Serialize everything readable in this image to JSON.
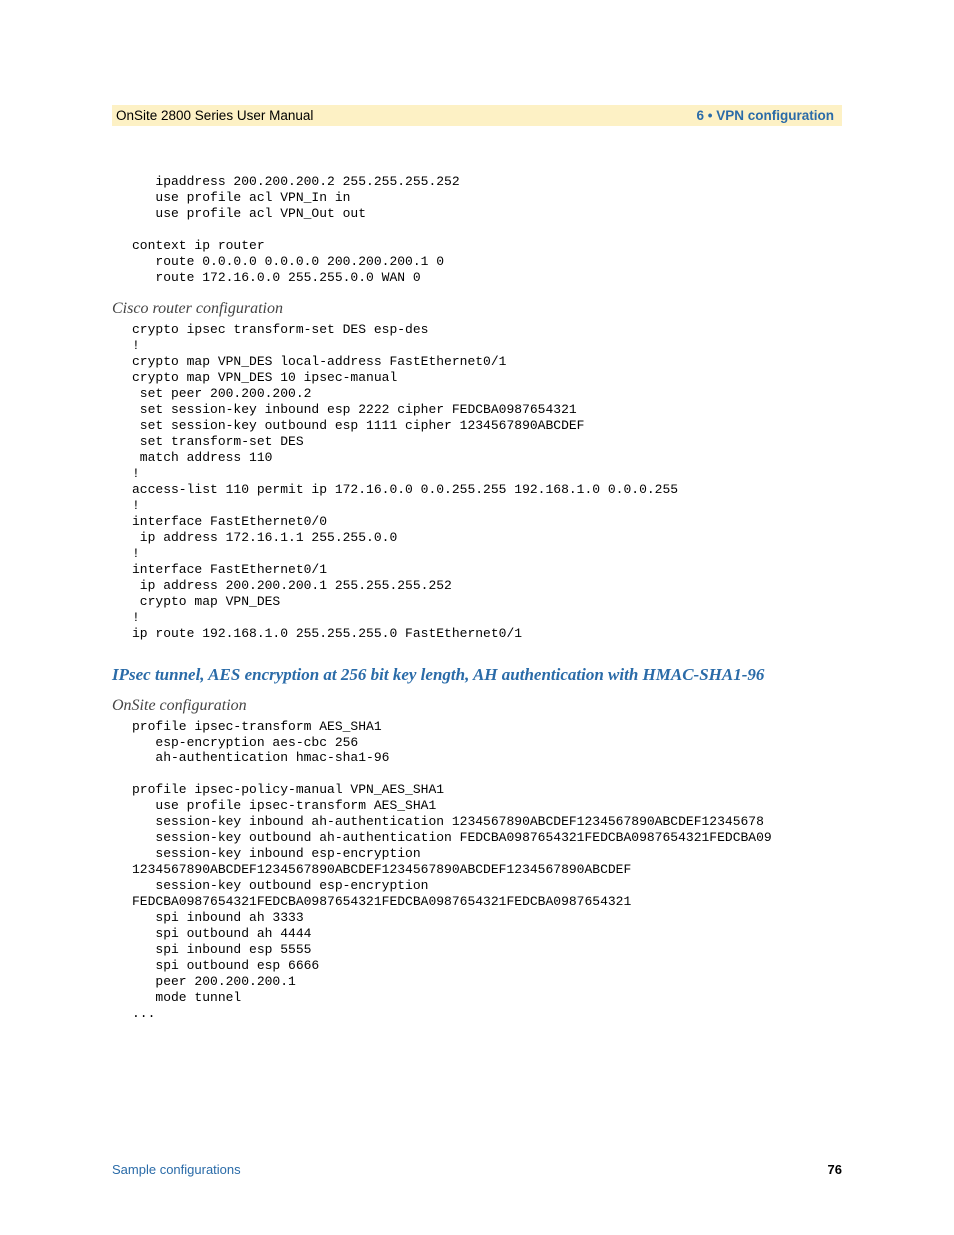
{
  "header": {
    "left": "OnSite 2800 Series User Manual",
    "right": "6 • VPN configuration"
  },
  "code1": "   ipaddress 200.200.200.2 255.255.255.252\n   use profile acl VPN_In in\n   use profile acl VPN_Out out\n\ncontext ip router\n   route 0.0.0.0 0.0.0.0 200.200.200.1 0\n   route 172.16.0.0 255.255.0.0 WAN 0",
  "subheading1": "Cisco router configuration",
  "code2": "crypto ipsec transform-set DES esp-des\n!\ncrypto map VPN_DES local-address FastEthernet0/1\ncrypto map VPN_DES 10 ipsec-manual\n set peer 200.200.200.2\n set session-key inbound esp 2222 cipher FEDCBA0987654321\n set session-key outbound esp 1111 cipher 1234567890ABCDEF\n set transform-set DES\n match address 110\n!\naccess-list 110 permit ip 172.16.0.0 0.0.255.255 192.168.1.0 0.0.0.255\n!\ninterface FastEthernet0/0\n ip address 172.16.1.1 255.255.0.0\n!\ninterface FastEthernet0/1\n ip address 200.200.200.1 255.255.255.252\n crypto map VPN_DES\n!\nip route 192.168.1.0 255.255.255.0 FastEthernet0/1",
  "section_heading": "IPsec tunnel, AES encryption at 256 bit key length, AH authentication with HMAC-SHA1-96",
  "subheading2": "OnSite configuration",
  "code3": "profile ipsec-transform AES_SHA1\n   esp-encryption aes-cbc 256\n   ah-authentication hmac-sha1-96\n\nprofile ipsec-policy-manual VPN_AES_SHA1\n   use profile ipsec-transform AES_SHA1\n   session-key inbound ah-authentication 1234567890ABCDEF1234567890ABCDEF12345678\n   session-key outbound ah-authentication FEDCBA0987654321FEDCBA0987654321FEDCBA09\n   session-key inbound esp-encryption \n1234567890ABCDEF1234567890ABCDEF1234567890ABCDEF1234567890ABCDEF\n   session-key outbound esp-encryption \nFEDCBA0987654321FEDCBA0987654321FEDCBA0987654321FEDCBA0987654321\n   spi inbound ah 3333\n   spi outbound ah 4444\n   spi inbound esp 5555\n   spi outbound esp 6666\n   peer 200.200.200.1\n   mode tunnel\n...",
  "footer": {
    "left": "Sample configurations",
    "right": "76"
  }
}
